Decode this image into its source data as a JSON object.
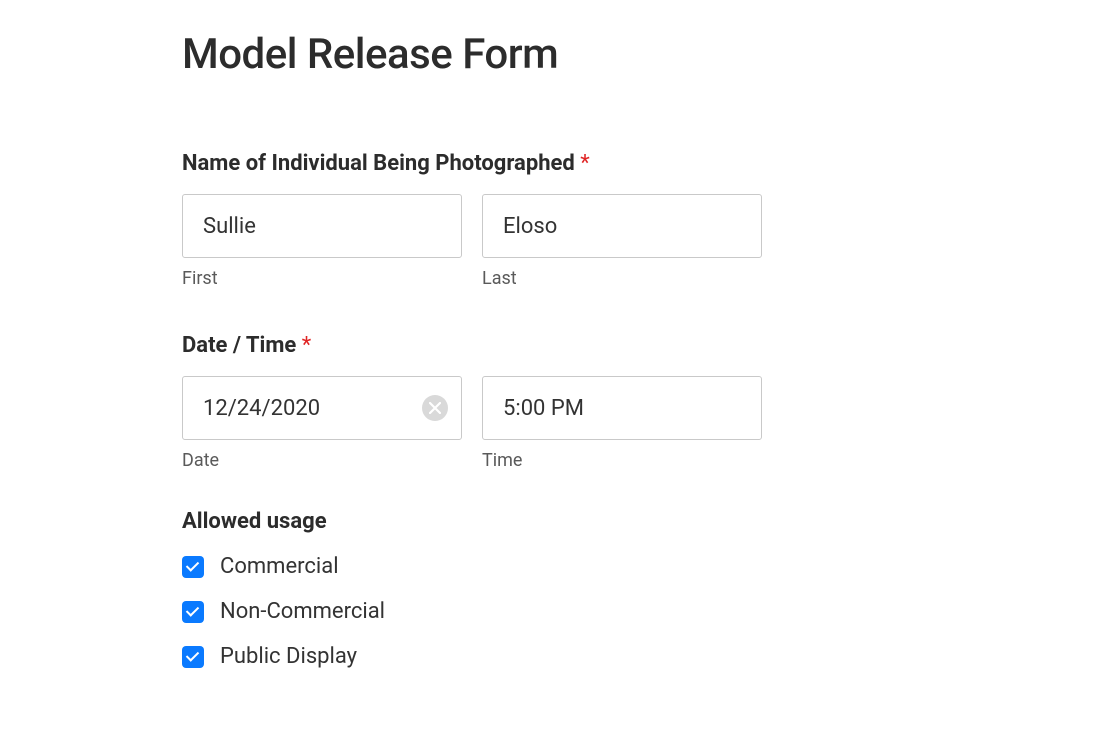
{
  "title": "Model Release Form",
  "name_section": {
    "label": "Name of Individual Being Photographed",
    "required_mark": "*",
    "first_value": "Sullie",
    "first_sublabel": "First",
    "last_value": "Eloso",
    "last_sublabel": "Last"
  },
  "datetime_section": {
    "label": "Date / Time",
    "required_mark": "*",
    "date_value": "12/24/2020",
    "date_sublabel": "Date",
    "time_value": "5:00 PM",
    "time_sublabel": "Time"
  },
  "usage_section": {
    "label": "Allowed usage",
    "options": {
      "commercial": "Commercial",
      "non_commercial": "Non-Commercial",
      "public_display": "Public Display"
    }
  }
}
